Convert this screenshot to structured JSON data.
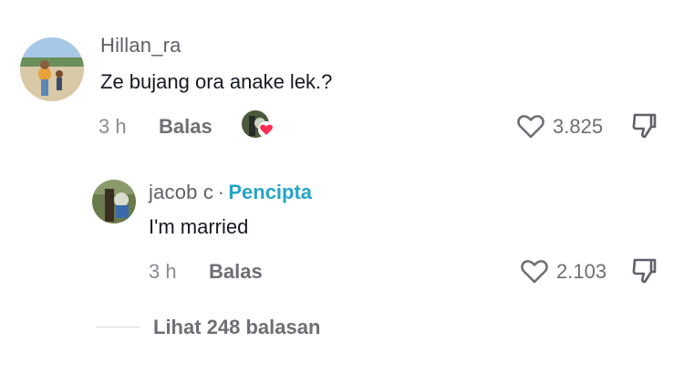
{
  "comment": {
    "username": "Hillan_ra",
    "text": "Ze bujang ora anake lek.?",
    "time": "3 h",
    "reply_label": "Balas",
    "likes": "3.825",
    "liked_by_creator_icon": "heart-badge-icon"
  },
  "reply": {
    "username": "jacob c",
    "separator": "·",
    "creator_label": "Pencipta",
    "text": "I'm married",
    "time": "3 h",
    "reply_label": "Balas",
    "likes": "2.103"
  },
  "view_replies_label": "Lihat 248 balasan",
  "colors": {
    "creator_accent": "#25a4c8",
    "heart_badge": "#fe2c55",
    "muted_text": "#6e6f75"
  },
  "icons": {
    "like": "heart-outline-icon",
    "dislike": "thumb-down-icon"
  }
}
